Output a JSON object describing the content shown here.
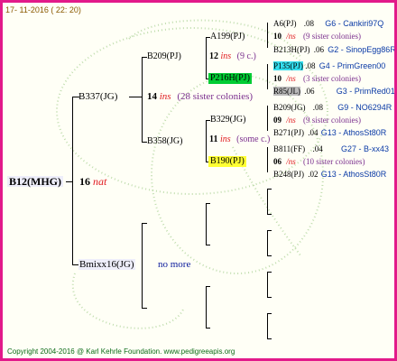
{
  "header": {
    "date": "17- 11-2016 ( 22: 20)"
  },
  "root": {
    "name": "B12(MHG)",
    "count": "16",
    "suffix": "nat"
  },
  "sire": {
    "name": "B337(JG)",
    "count": "14",
    "suffix": "ins",
    "siblings": "(28 sister colonies)"
  },
  "dam": {
    "name": "Bmixx16(JG)",
    "note": "no more"
  },
  "sire_sire": {
    "name": "B209(PJ)",
    "count": "12",
    "suffix": "ins",
    "siblings": "(9 c.)"
  },
  "sire_dam": {
    "name": "B358(JG)",
    "count": "11",
    "suffix": "ins",
    "siblings": "(some c.)"
  },
  "gg1": {
    "name": "A199(PJ)"
  },
  "gg2": {
    "name": "P216H(PJ)",
    "highlight": "#00cc33"
  },
  "gg3": {
    "name": "B329(JG)"
  },
  "gg4": {
    "name": "B190(PJ)",
    "highlight": "#ffff33"
  },
  "right": [
    {
      "name": "A6(PJ)",
      "val": ".08",
      "link": "G6 - Cankiri97Q"
    },
    {
      "count": "10",
      "suffix": "/ns",
      "sib": "(9 sister colonies)"
    },
    {
      "name": "B213H(PJ)",
      "val": ".06",
      "link": "G2 - SinopEgg86R"
    },
    {
      "name": "P135(PJ)",
      "val": ".08",
      "link": "G4 - PrimGreen00",
      "highlight": "#33ddee"
    },
    {
      "count": "10",
      "suffix": "/ns",
      "sib": "(3 sister colonies)"
    },
    {
      "name": "R85(JL)",
      "val": ".06",
      "link": "G3 - PrimRed01",
      "highlight": "#bbbbbb"
    },
    {
      "name": "B209(JG)",
      "val": ".08",
      "link": "G9 - NO6294R"
    },
    {
      "count": "09",
      "suffix": "/ns",
      "sib": "(9 sister colonies)"
    },
    {
      "name": "B271(PJ)",
      "val": ".04",
      "link": "G13 - AthosSt80R"
    },
    {
      "name": "B811(FF)",
      "val": ".04",
      "link": "G27 - B-xx43"
    },
    {
      "count": "06",
      "suffix": "/ns",
      "sib": "(10 sister colonies)"
    },
    {
      "name": "B248(PJ)",
      "val": ".02",
      "link": "G13 - AthosSt80R"
    }
  ],
  "footer": {
    "text": "Copyright 2004-2016 @ Karl Kehrle Foundation.   www.pedigreeapis.org"
  },
  "colors": {
    "frame": "#e21a8a",
    "ins": "#e0191e",
    "sisters": "#7b2f8e",
    "links": "#0a3aa6"
  }
}
